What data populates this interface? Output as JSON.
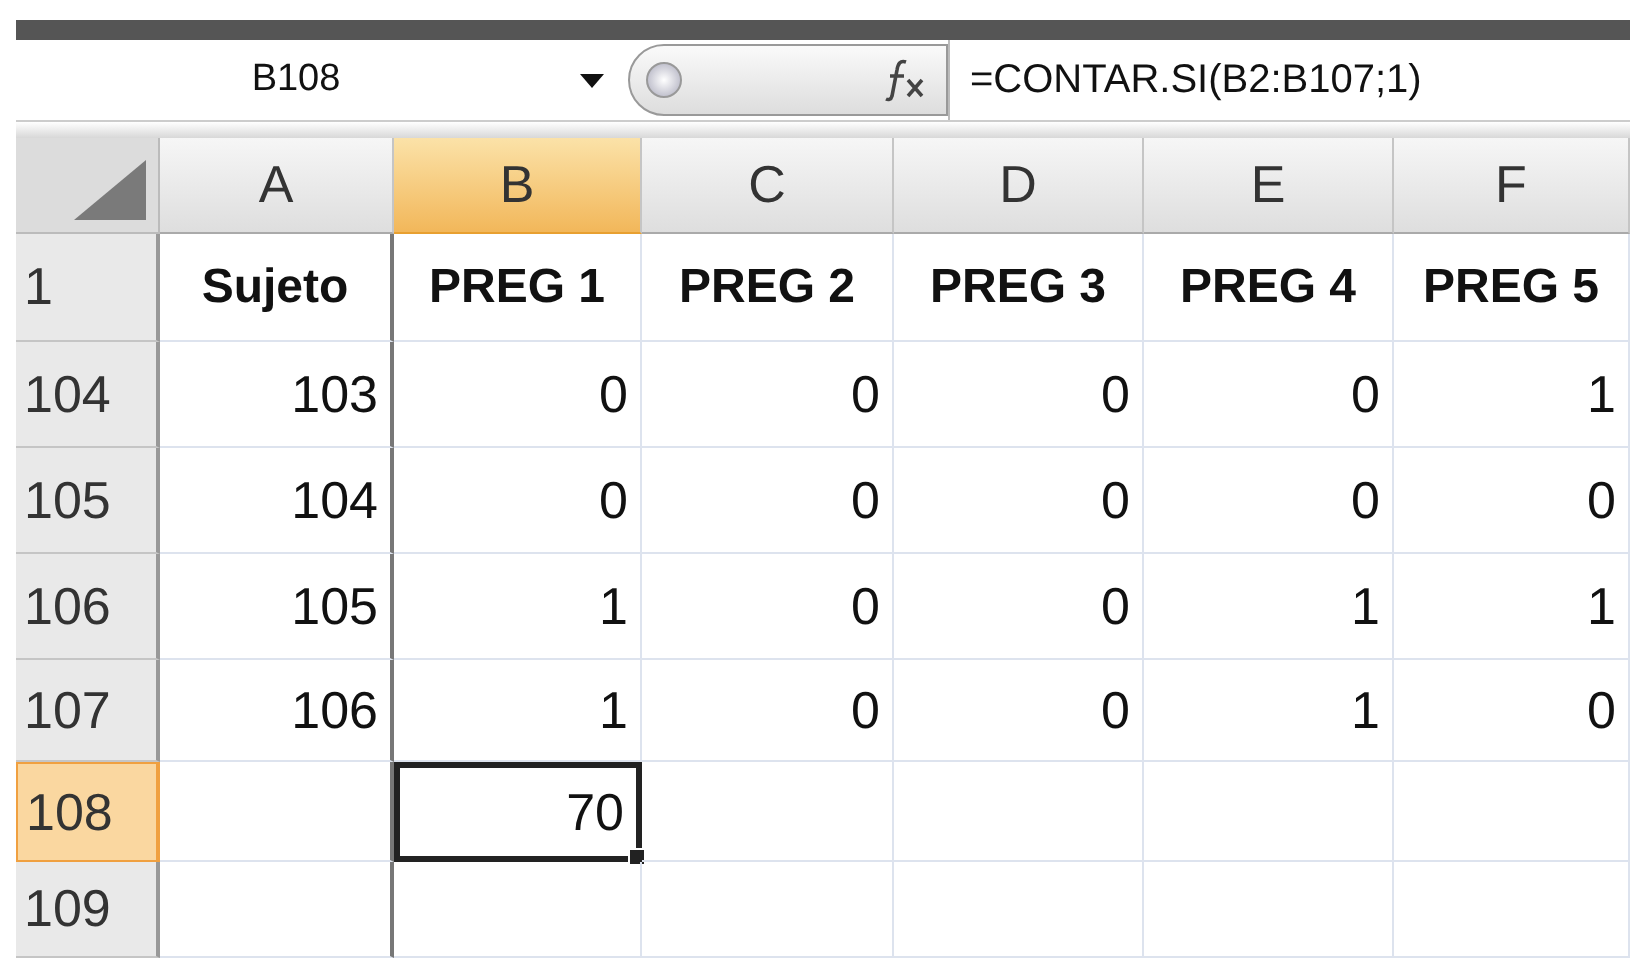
{
  "formula_bar": {
    "name_box": "B108",
    "formula": "=CONTAR.SI(B2:B107;1)"
  },
  "columns": [
    {
      "label": "A",
      "selected": false
    },
    {
      "label": "B",
      "selected": true
    },
    {
      "label": "C",
      "selected": false
    },
    {
      "label": "D",
      "selected": false
    },
    {
      "label": "E",
      "selected": false
    },
    {
      "label": "F",
      "selected": false
    }
  ],
  "rows": [
    {
      "header": "1",
      "selected": false,
      "kind": "title",
      "cells": [
        {
          "value": "Sujeto",
          "selected": false
        },
        {
          "value": "PREG 1",
          "selected": false
        },
        {
          "value": "PREG 2",
          "selected": false
        },
        {
          "value": "PREG 3",
          "selected": false
        },
        {
          "value": "PREG 4",
          "selected": false
        },
        {
          "value": "PREG 5",
          "selected": false
        }
      ]
    },
    {
      "header": "104",
      "selected": false,
      "kind": "data",
      "cells": [
        {
          "value": "103",
          "selected": false
        },
        {
          "value": "0",
          "selected": false
        },
        {
          "value": "0",
          "selected": false
        },
        {
          "value": "0",
          "selected": false
        },
        {
          "value": "0",
          "selected": false
        },
        {
          "value": "1",
          "selected": false
        }
      ]
    },
    {
      "header": "105",
      "selected": false,
      "kind": "data",
      "cells": [
        {
          "value": "104",
          "selected": false
        },
        {
          "value": "0",
          "selected": false
        },
        {
          "value": "0",
          "selected": false
        },
        {
          "value": "0",
          "selected": false
        },
        {
          "value": "0",
          "selected": false
        },
        {
          "value": "0",
          "selected": false
        }
      ]
    },
    {
      "header": "106",
      "selected": false,
      "kind": "data",
      "cells": [
        {
          "value": "105",
          "selected": false
        },
        {
          "value": "1",
          "selected": false
        },
        {
          "value": "0",
          "selected": false
        },
        {
          "value": "0",
          "selected": false
        },
        {
          "value": "1",
          "selected": false
        },
        {
          "value": "1",
          "selected": false
        }
      ]
    },
    {
      "header": "107",
      "selected": false,
      "kind": "data",
      "cells": [
        {
          "value": "106",
          "selected": false
        },
        {
          "value": "1",
          "selected": false
        },
        {
          "value": "0",
          "selected": false
        },
        {
          "value": "0",
          "selected": false
        },
        {
          "value": "1",
          "selected": false
        },
        {
          "value": "0",
          "selected": false
        }
      ]
    },
    {
      "header": "108",
      "selected": true,
      "kind": "data",
      "cells": [
        {
          "selected": false
        },
        {
          "value": "70",
          "selected": true
        },
        {
          "selected": false
        },
        {
          "selected": false
        },
        {
          "selected": false
        },
        {
          "selected": false
        }
      ]
    },
    {
      "header": "109",
      "selected": false,
      "kind": "data",
      "cells": [
        {
          "selected": false
        },
        {
          "selected": false
        },
        {
          "selected": false
        },
        {
          "selected": false
        },
        {
          "selected": false
        },
        {
          "selected": false
        }
      ]
    }
  ]
}
